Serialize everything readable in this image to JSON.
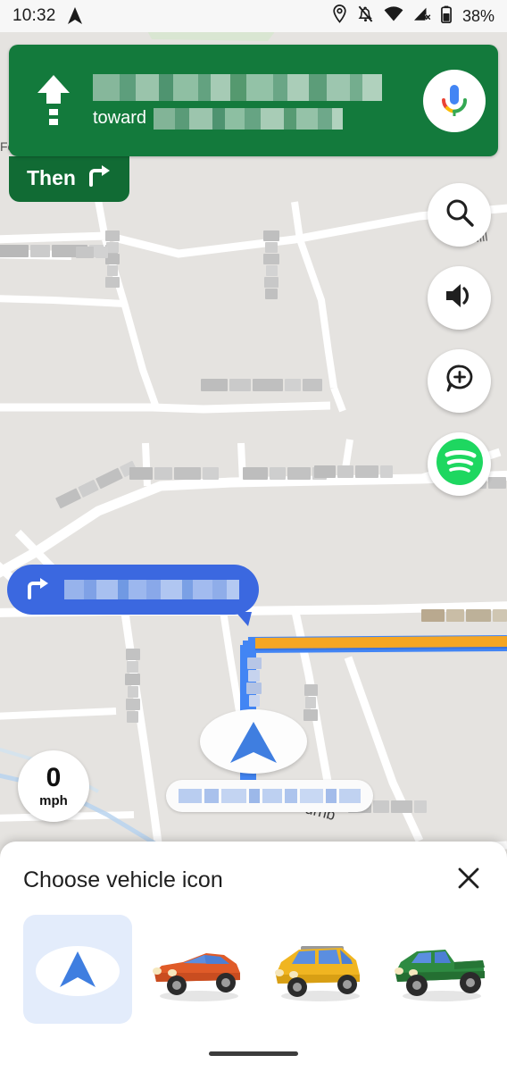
{
  "status_bar": {
    "time": "10:32",
    "battery_percent": "38%",
    "icons": [
      "navigation-arrow-icon",
      "location-pin-icon",
      "notifications-off-icon",
      "wifi-icon",
      "cellular-off-icon",
      "battery-icon"
    ]
  },
  "navigation": {
    "maneuver": "continue-straight",
    "street_name": "Orange Park Grove",
    "street_redacted": true,
    "toward_label": "toward",
    "toward_name": "Orange Park",
    "toward_redacted": true,
    "assistant_button": "google-assistant-mic",
    "then": {
      "label": "Then",
      "maneuver": "turn-right"
    },
    "banner_color": "#137a3c",
    "then_color": "#116b34"
  },
  "map_controls": [
    {
      "name": "search",
      "icon": "search-icon"
    },
    {
      "name": "sound",
      "icon": "volume-icon"
    },
    {
      "name": "report",
      "icon": "report-incident-icon"
    },
    {
      "name": "spotify",
      "icon": "spotify-icon",
      "color": "#1ED760"
    }
  ],
  "turn_callout": {
    "maneuver": "turn-right",
    "street_name": "Orange Park Rd",
    "redacted": true,
    "color": "#3b68e0"
  },
  "speedometer": {
    "value": "0",
    "unit": "mph"
  },
  "user_marker": {
    "type": "navigation-chevron",
    "color": "#3f7ee0",
    "street_label": "Orange Park Street",
    "label_redacted": true
  },
  "route": {
    "active_color": "#4285f4",
    "traffic_color": "#f5a623"
  },
  "map_labels": [
    {
      "text": "Fe",
      "redacted": false
    },
    {
      "text": "Mill",
      "redacted": false
    },
    {
      "text": "Turnb",
      "redacted": false
    }
  ],
  "bottom_sheet": {
    "title": "Choose vehicle icon",
    "close_icon": "close-icon",
    "options": [
      {
        "id": "arrow",
        "label": "Default navigation arrow",
        "selected": true,
        "body": "#3f7ee0",
        "accent": "#ffffff"
      },
      {
        "id": "sedan",
        "label": "Red sedan",
        "selected": false,
        "body": "#e05b28",
        "accent": "#5b8ee0"
      },
      {
        "id": "suv",
        "label": "Yellow SUV",
        "selected": false,
        "body": "#f0b521",
        "accent": "#5b8ee0"
      },
      {
        "id": "truck",
        "label": "Green pickup truck",
        "selected": false,
        "body": "#2e8b42",
        "accent": "#5b8ee0"
      }
    ]
  }
}
